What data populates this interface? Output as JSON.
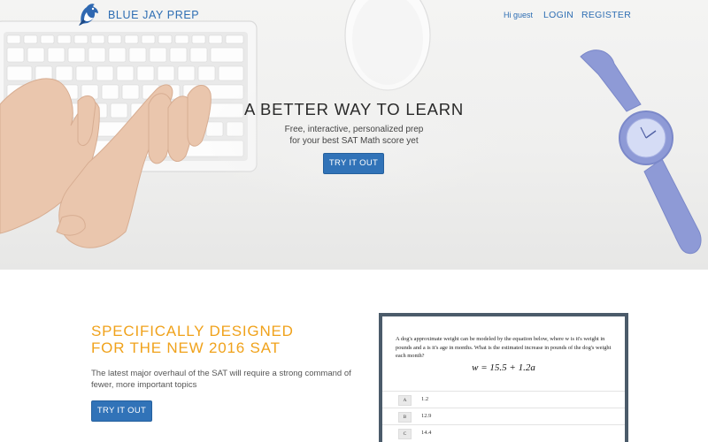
{
  "colors": {
    "brand_blue": "#2e6eb3",
    "button_blue": "#3173b8",
    "accent_orange": "#f0a21b",
    "card_border": "#4b5b6a"
  },
  "nav": {
    "logo_icon": "blue-jay-bird-icon",
    "brand": "BLUE JAY PREP",
    "greeting": "Hi guest",
    "login": "LOGIN",
    "register": "REGISTER"
  },
  "hero": {
    "title": "A BETTER WAY TO LEARN",
    "subtitle_line1": "Free, interactive, personalized prep",
    "subtitle_line2": "for your best SAT Math score yet",
    "cta": "TRY IT OUT"
  },
  "feature": {
    "heading_line1": "SPECIFICALLY DESIGNED",
    "heading_line2": "FOR THE NEW 2016 SAT",
    "text": "The latest major overhaul of the SAT will require a strong command of fewer, more important topics",
    "cta": "TRY IT OUT"
  },
  "question": {
    "text": "A dog's approximate weight can be modeled by the equation below, where w is it's weight in pounds and a is it's age in months. What is the estimated increase in pounds of the dog's weight each month?",
    "equation": "w = 15.5 + 1.2a",
    "choices": [
      {
        "letter": "A",
        "value": "1.2"
      },
      {
        "letter": "B",
        "value": "12.9"
      },
      {
        "letter": "C",
        "value": "14.4"
      }
    ]
  }
}
